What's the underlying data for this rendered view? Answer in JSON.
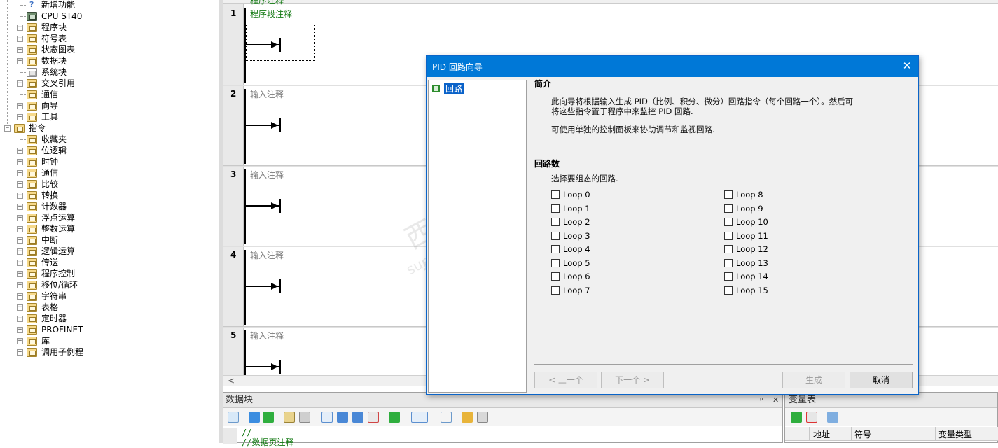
{
  "tree": {
    "items": [
      {
        "label": "新增功能",
        "indent": 2,
        "icon": "help-icon",
        "expandable": false
      },
      {
        "label": "CPU ST40",
        "indent": 2,
        "icon": "cpu-icon",
        "expandable": false
      },
      {
        "label": "程序块",
        "indent": 2,
        "icon": "folder-icon",
        "expandable": true
      },
      {
        "label": "符号表",
        "indent": 2,
        "icon": "folder-icon",
        "expandable": true
      },
      {
        "label": "状态图表",
        "indent": 2,
        "icon": "folder-icon",
        "expandable": true
      },
      {
        "label": "数据块",
        "indent": 2,
        "icon": "folder-icon",
        "expandable": true
      },
      {
        "label": "系统块",
        "indent": 2,
        "icon": "page-icon",
        "expandable": false
      },
      {
        "label": "交叉引用",
        "indent": 2,
        "icon": "folder-icon",
        "expandable": true
      },
      {
        "label": "通信",
        "indent": 2,
        "icon": "network-icon",
        "expandable": false
      },
      {
        "label": "向导",
        "indent": 2,
        "icon": "wizard-icon",
        "expandable": true
      },
      {
        "label": "工具",
        "indent": 2,
        "icon": "folder-icon",
        "expandable": true
      },
      {
        "label": "指令",
        "indent": 1,
        "icon": "folder-icon",
        "expandable": true,
        "expanded": true
      },
      {
        "label": "收藏夹",
        "indent": 2,
        "icon": "folder-icon",
        "expandable": false
      },
      {
        "label": "位逻辑",
        "indent": 2,
        "icon": "folder-icon",
        "expandable": true
      },
      {
        "label": "时钟",
        "indent": 2,
        "icon": "clock-icon",
        "expandable": true
      },
      {
        "label": "通信",
        "indent": 2,
        "icon": "folder-icon",
        "expandable": true
      },
      {
        "label": "比较",
        "indent": 2,
        "icon": "folder-icon",
        "expandable": true
      },
      {
        "label": "转换",
        "indent": 2,
        "icon": "folder-icon",
        "expandable": true
      },
      {
        "label": "计数器",
        "indent": 2,
        "icon": "folder-icon",
        "expandable": true
      },
      {
        "label": "浮点运算",
        "indent": 2,
        "icon": "folder-icon",
        "expandable": true
      },
      {
        "label": "整数运算",
        "indent": 2,
        "icon": "folder-icon",
        "expandable": true
      },
      {
        "label": "中断",
        "indent": 2,
        "icon": "folder-icon",
        "expandable": true
      },
      {
        "label": "逻辑运算",
        "indent": 2,
        "icon": "folder-icon",
        "expandable": true
      },
      {
        "label": "传送",
        "indent": 2,
        "icon": "folder-icon",
        "expandable": true
      },
      {
        "label": "程序控制",
        "indent": 2,
        "icon": "folder-icon",
        "expandable": true
      },
      {
        "label": "移位/循环",
        "indent": 2,
        "icon": "folder-icon",
        "expandable": true
      },
      {
        "label": "字符串",
        "indent": 2,
        "icon": "folder-icon",
        "expandable": true
      },
      {
        "label": "表格",
        "indent": 2,
        "icon": "folder-icon",
        "expandable": true
      },
      {
        "label": "定时器",
        "indent": 2,
        "icon": "folder-icon",
        "expandable": true
      },
      {
        "label": "PROFINET",
        "indent": 2,
        "icon": "folder-icon",
        "expandable": true
      },
      {
        "label": "库",
        "indent": 2,
        "icon": "folder-icon",
        "expandable": true
      },
      {
        "label": "调用子例程",
        "indent": 2,
        "icon": "folder-icon",
        "expandable": true
      }
    ]
  },
  "editor": {
    "top_comment": "程序注释",
    "networks": [
      {
        "num": "1",
        "comment": "程序段注释"
      },
      {
        "num": "2",
        "comment": "输入注释"
      },
      {
        "num": "3",
        "comment": "输入注释"
      },
      {
        "num": "4",
        "comment": "输入注释"
      },
      {
        "num": "5",
        "comment": "输入注释"
      }
    ],
    "scroll_left": "<"
  },
  "datablock": {
    "title": "数据块",
    "pin": "ᵖ",
    "close": "✕",
    "lines": [
      "//",
      "//数据页注释"
    ]
  },
  "vartable": {
    "title": "变量表",
    "columns": [
      "地址",
      "符号",
      "变量类型"
    ]
  },
  "dialog": {
    "title": "PID 回路向导",
    "close": "✕",
    "tree_node": "回路",
    "intro_heading": "简介",
    "intro_line1": "此向导将根据输入生成 PID（比例、积分、微分）回路指令（每个回路一个）。然后可",
    "intro_line2": "将这些指令置于程序中来监控 PID 回路.",
    "intro_line3": "可使用单独的控制面板来协助调节和监视回路.",
    "loops_heading": "回路数",
    "loops_prompt": "选择要组态的回路.",
    "loops": [
      "Loop 0",
      "Loop 1",
      "Loop 2",
      "Loop 3",
      "Loop 4",
      "Loop 5",
      "Loop 6",
      "Loop 7",
      "Loop 8",
      "Loop 9",
      "Loop 10",
      "Loop 11",
      "Loop 12",
      "Loop 13",
      "Loop 14",
      "Loop 15"
    ],
    "btn_prev": "< 上一个",
    "btn_next": "下一个 >",
    "btn_generate": "生成",
    "btn_cancel": "取消"
  },
  "watermark": {
    "line1": "西门子工业  技术支持",
    "line2": "support.industry.siemens.com/cs"
  },
  "colors": {
    "titlebar": "#0078d7",
    "comment_green": "#137a13",
    "selection": "#0a62c9"
  }
}
